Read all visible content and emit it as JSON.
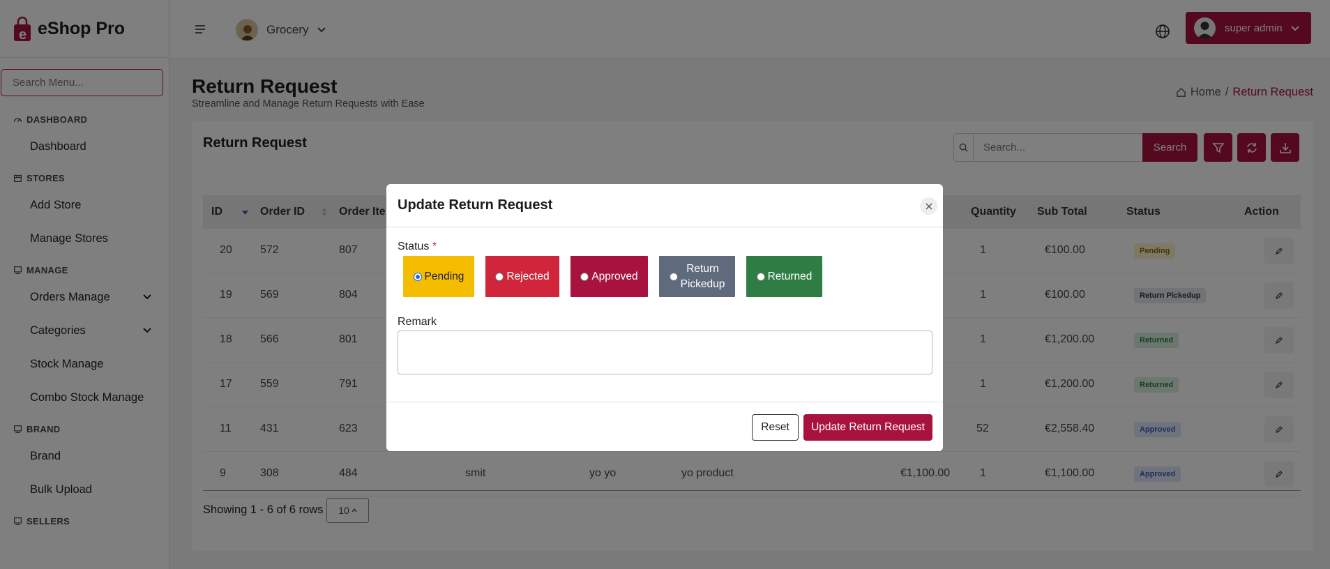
{
  "app": {
    "name": "eShop Pro"
  },
  "sidebar": {
    "search_placeholder": "Search Menu...",
    "sections": {
      "dashboard": {
        "title": "DASHBOARD",
        "items": [
          "Dashboard"
        ]
      },
      "stores": {
        "title": "STORES",
        "items": [
          "Add Store",
          "Manage Stores"
        ]
      },
      "manage": {
        "title": "MANAGE",
        "items": [
          "Orders Manage",
          "Categories",
          "Stock Manage",
          "Combo Stock Manage"
        ]
      },
      "brand": {
        "title": "BRAND",
        "items": [
          "Brand",
          "Bulk Upload"
        ]
      },
      "sellers": {
        "title": "SELLERS"
      }
    }
  },
  "topbar": {
    "store": "Grocery",
    "user": "super admin"
  },
  "page": {
    "title": "Return Request",
    "subtitle": "Streamline and Manage Return Requests with Ease",
    "breadcrumb": {
      "home": "Home",
      "separator": "/",
      "current": "Return Request"
    }
  },
  "card": {
    "title": "Return Request",
    "search_placeholder": "Search...",
    "search_button": "Search"
  },
  "table": {
    "headers": {
      "id": "ID",
      "order_id": "Order ID",
      "order_item": "Order Ite",
      "quantity": "Quantity",
      "sub_total": "Sub Total",
      "status": "Status",
      "action": "Action"
    },
    "rows": [
      {
        "id": "20",
        "order_id": "572",
        "order_item": "807",
        "user": "",
        "seller": "",
        "product": "",
        "price": "",
        "quantity": "1",
        "sub_total": "€100.00",
        "status": "Pending"
      },
      {
        "id": "19",
        "order_id": "569",
        "order_item": "804",
        "user": "",
        "seller": "",
        "product": "",
        "price": "",
        "quantity": "1",
        "sub_total": "€100.00",
        "status": "Return Pickedup"
      },
      {
        "id": "18",
        "order_id": "566",
        "order_item": "801",
        "user": "",
        "seller": "",
        "product": "",
        "price": "",
        "quantity": "1",
        "sub_total": "€1,200.00",
        "status": "Returned"
      },
      {
        "id": "17",
        "order_id": "559",
        "order_item": "791",
        "user": "",
        "seller": "",
        "product": "",
        "price": "",
        "quantity": "1",
        "sub_total": "€1,200.00",
        "status": "Returned"
      },
      {
        "id": "11",
        "order_id": "431",
        "order_item": "623",
        "user": "",
        "seller": "",
        "product": "",
        "price": "",
        "quantity": "52",
        "sub_total": "€2,558.40",
        "status": "Approved"
      },
      {
        "id": "9",
        "order_id": "308",
        "order_item": "484",
        "user": "smit",
        "seller": "yo yo",
        "product": "yo product",
        "price": "€1,100.00",
        "quantity": "1",
        "sub_total": "€1,100.00",
        "status": "Approved"
      }
    ],
    "showing": "Showing 1 - 6 of 6 rows",
    "page_size": "10"
  },
  "modal": {
    "title": "Update Return Request",
    "status_label": "Status",
    "required_mark": "*",
    "options": {
      "pending": "Pending",
      "rejected": "Rejected",
      "approved": "Approved",
      "pickedup_1": "Return",
      "pickedup_2": "Pickedup",
      "returned": "Returned"
    },
    "selected": "Pending",
    "remark_label": "Remark",
    "remark_value": "",
    "reset_button": "Reset",
    "update_button": "Update Return Request"
  },
  "colors": {
    "brand": "#a8123e",
    "pending": "#f5bd00",
    "rejected": "#d0253a",
    "approved": "#a8123e",
    "pickedup": "#5f6b7d",
    "returned": "#2e7d45"
  }
}
